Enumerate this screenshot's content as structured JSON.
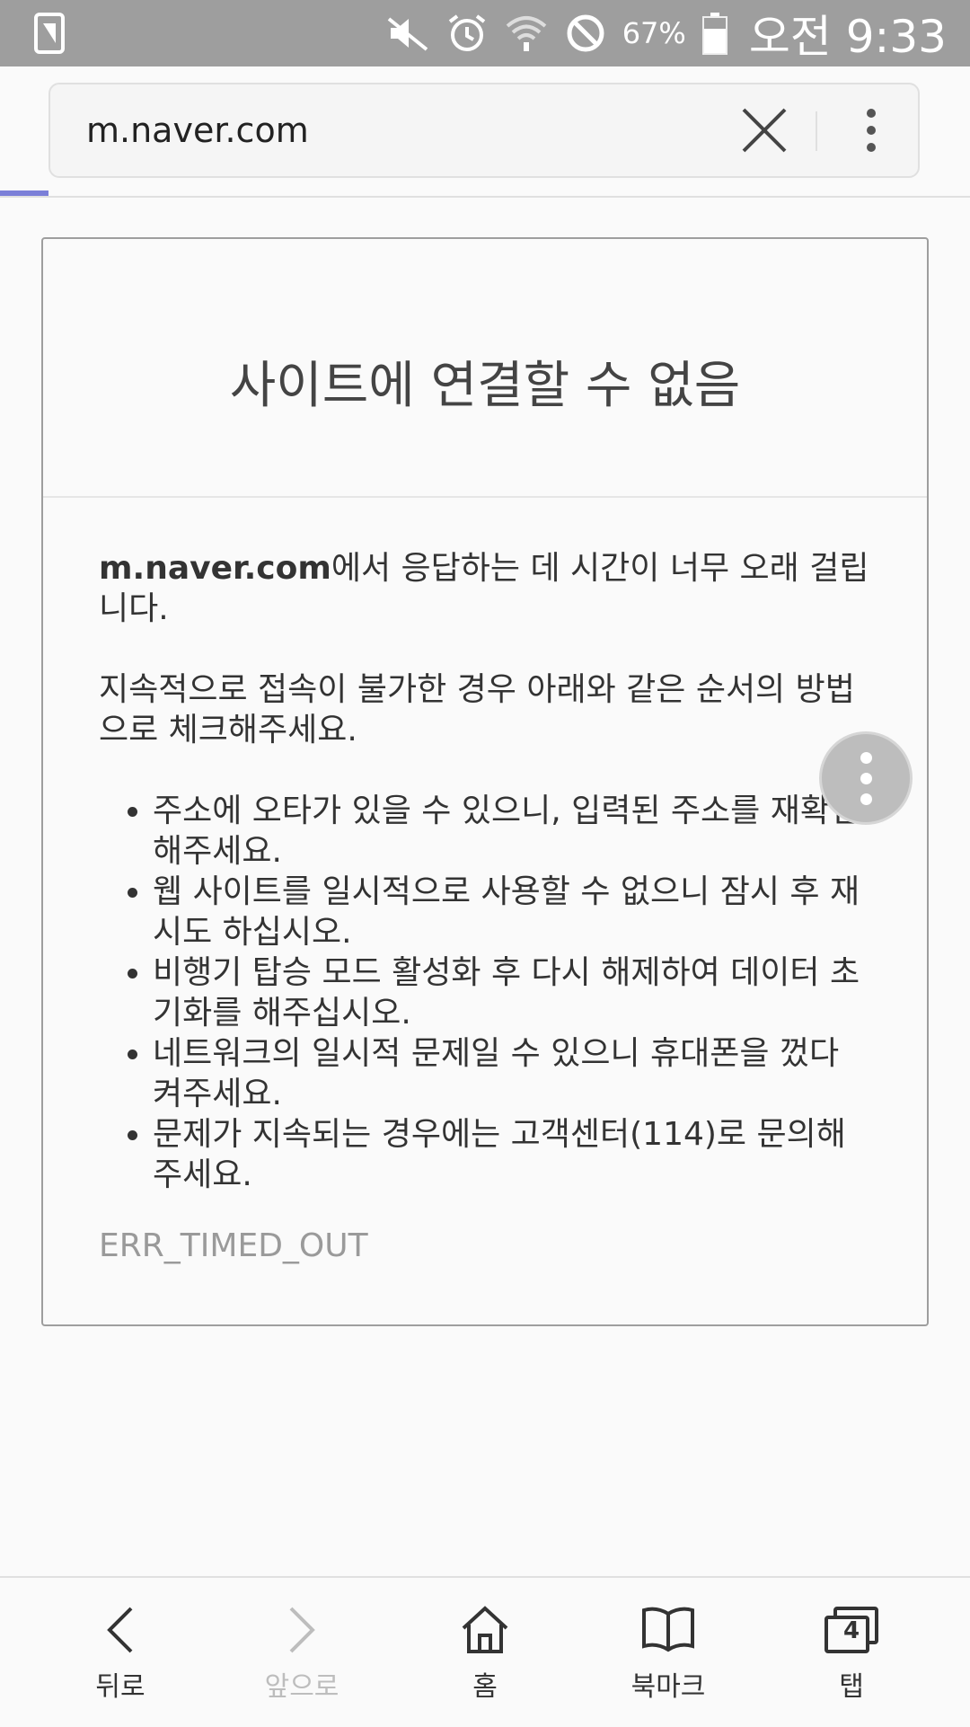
{
  "status_bar": {
    "battery_percent": "67%",
    "time": "오전 9:33"
  },
  "address_bar": {
    "url": "m.naver.com"
  },
  "error_page": {
    "title": "사이트에 연결할 수 없음",
    "host": "m.naver.com",
    "message_suffix": "에서 응답하는 데 시간이 너무 오래 걸립니다.",
    "instruction": "지속적으로 접속이 불가한 경우 아래와 같은 순서의 방법으로 체크해주세요.",
    "steps": [
      "주소에 오타가 있을 수 있으니, 입력된 주소를 재확인해주세요.",
      "웹 사이트를 일시적으로 사용할 수 없으니 잠시 후 재시도 하십시오.",
      "비행기 탑승 모드 활성화 후 다시 해제하여 데이터 초기화를 해주십시오.",
      "네트워크의 일시적 문제일 수 있으니 휴대폰을 껐다 켜주세요.",
      "문제가 지속되는 경우에는 고객센터(114)로 문의해주세요."
    ],
    "error_code": "ERR_TIMED_OUT"
  },
  "bottom_nav": {
    "back": "뒤로",
    "forward": "앞으로",
    "home": "홈",
    "bookmarks": "북마크",
    "tabs": "탭",
    "tab_count": "4"
  },
  "colors": {
    "status_bar": "#9e9e9e",
    "progress": "#7b7fd8",
    "disabled": "#bdbdbd"
  }
}
